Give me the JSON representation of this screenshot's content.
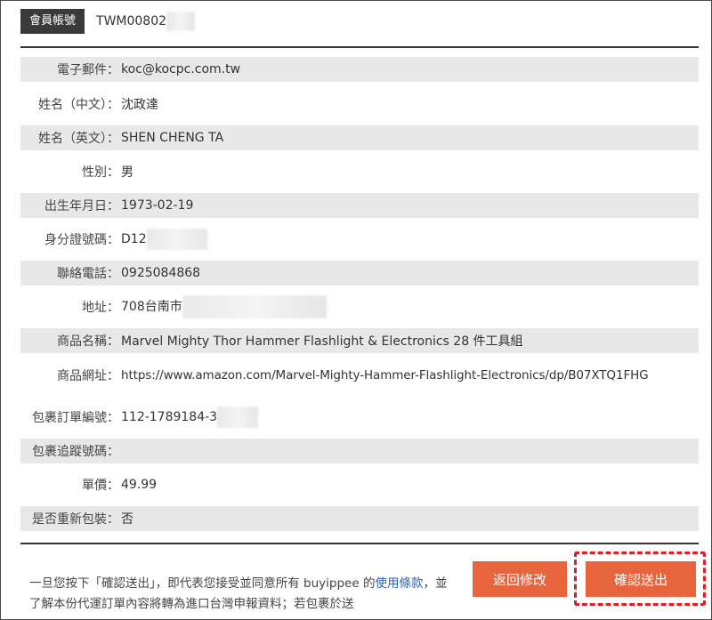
{
  "header": {
    "badge": "會員帳號",
    "account_id": "TWM00802"
  },
  "fields": [
    {
      "label": "電子郵件：",
      "value": "koc@kocpc.com.tw"
    },
    {
      "label": "姓名（中文）：",
      "value": "沈政達"
    },
    {
      "label": "姓名（英文）：",
      "value": "SHEN CHENG TA"
    },
    {
      "label": "性別：",
      "value": "男"
    },
    {
      "label": "出生年月日：",
      "value": "1973-02-19"
    },
    {
      "label": "身分證號碼：",
      "value": "D12"
    },
    {
      "label": "聯絡電話：",
      "value": "0925084868"
    },
    {
      "label": "地址：",
      "value": "708台南市"
    },
    {
      "label": "商品名稱：",
      "value": "Marvel Mighty Thor Hammer Flashlight & Electronics 28 件工具組"
    },
    {
      "label": "商品網址：",
      "value": "https://www.amazon.com/Marvel-Mighty-Hammer-Flashlight-Electronics/dp/B07XTQ1FHG"
    },
    {
      "label": "包裹訂單編號：",
      "value": "112-1789184-3"
    },
    {
      "label": "包裹追蹤號碼：",
      "value": ""
    },
    {
      "label": "單價：",
      "value": "49.99"
    },
    {
      "label": "是否重新包裝：",
      "value": "否"
    }
  ],
  "notice": {
    "text_before": "一旦您按下「確認送出」，即代表您接受並同意所有 buyippee 的",
    "link_text": "使用條款",
    "text_after": "，並了解本份代運訂單內容將轉為進口台灣申報資料；若包裹於送"
  },
  "buttons": {
    "back": "返回修改",
    "confirm": "確認送出"
  },
  "colors": {
    "button": "#e8643d",
    "highlight_border": "#d8222a",
    "link": "#2f63b8"
  }
}
